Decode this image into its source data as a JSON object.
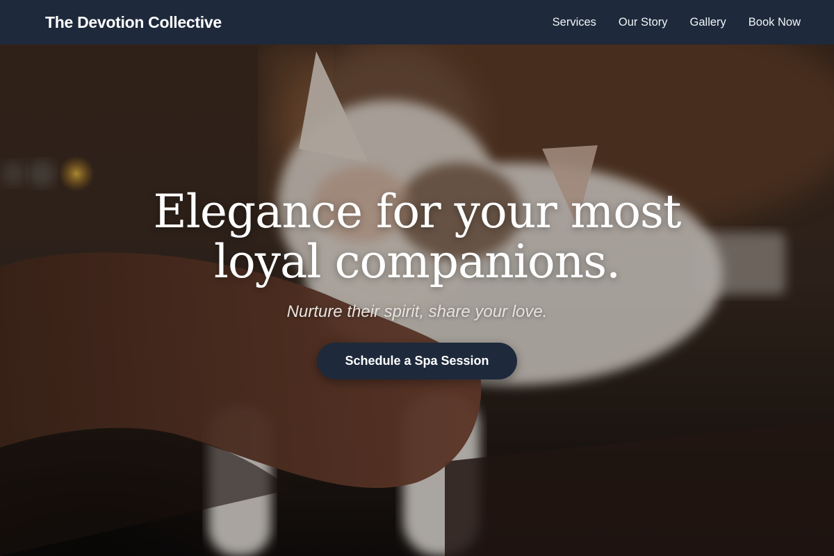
{
  "header": {
    "brand": "The Devotion Collective",
    "nav": [
      {
        "label": "Services"
      },
      {
        "label": "Our Story"
      },
      {
        "label": "Gallery"
      },
      {
        "label": "Book Now"
      }
    ]
  },
  "hero": {
    "headline": "Elegance for your most loyal companions.",
    "subheadline": "Nurture their spirit, share your love.",
    "cta_label": "Schedule a Spa Session",
    "background_image": "cat-being-petted-photo"
  },
  "colors": {
    "nav_background": "#1e293b",
    "button_background": "#1e293b",
    "text_primary": "#ffffff"
  }
}
